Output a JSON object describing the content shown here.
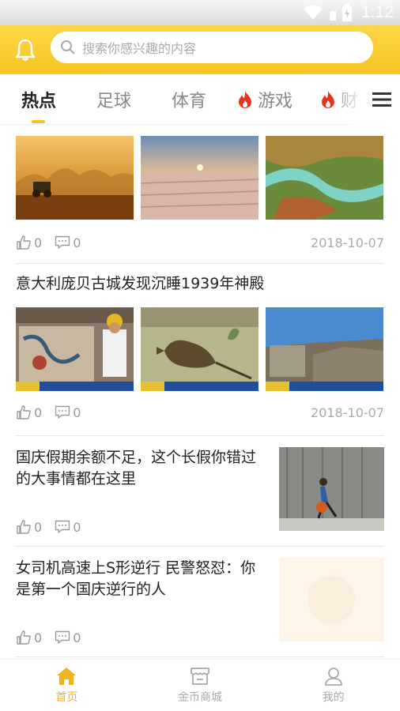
{
  "status": {
    "time": "1:12"
  },
  "search": {
    "placeholder": "搜索你感兴趣的内容"
  },
  "tabs": [
    {
      "label": "热点",
      "active": true,
      "hot": false
    },
    {
      "label": "足球",
      "active": false,
      "hot": false
    },
    {
      "label": "体育",
      "active": false,
      "hot": false
    },
    {
      "label": "游戏",
      "active": false,
      "hot": true
    },
    {
      "label": "财",
      "active": false,
      "hot": true
    }
  ],
  "articles": [
    {
      "title": "",
      "likes": "0",
      "comments": "0",
      "date": "2018-10-07"
    },
    {
      "title": "意大利庞贝古城发现沉睡1939年神殿",
      "likes": "0",
      "comments": "0",
      "date": "2018-10-07"
    },
    {
      "title": "国庆假期余额不足，这个长假你错过的大事情都在这里",
      "likes": "0",
      "comments": "0",
      "date": ""
    },
    {
      "title": "女司机高速上S形逆行 民警怒怼：你是第一个国庆逆行的人",
      "likes": "0",
      "comments": "0",
      "date": ""
    }
  ],
  "bottom_nav": [
    {
      "label": "首页",
      "icon": "home-icon",
      "active": true
    },
    {
      "label": "金币商城",
      "icon": "store-icon",
      "active": false
    },
    {
      "label": "我的",
      "icon": "profile-icon",
      "active": false
    }
  ],
  "colors": {
    "accent": "#f7c523",
    "nav_active": "#f2b41c",
    "muted": "#999999"
  }
}
